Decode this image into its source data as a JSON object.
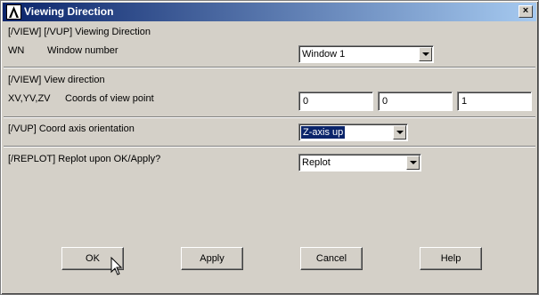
{
  "window": {
    "title": "Viewing Direction",
    "close_glyph": "×"
  },
  "section1": {
    "heading": "[/VIEW] [/VUP] Viewing Direction",
    "wn_label": "WN",
    "wn_desc": "Window number",
    "wn_value": "Window 1"
  },
  "section2": {
    "heading": "[/VIEW]  View direction",
    "coords_label": "XV,YV,ZV",
    "coords_desc": "Coords of view point",
    "xv": "0",
    "yv": "0",
    "zv": "1"
  },
  "section3": {
    "label": "[/VUP]  Coord axis orientation",
    "value": "Z-axis up"
  },
  "section4": {
    "label": "[/REPLOT] Replot upon OK/Apply?",
    "value": "Replot"
  },
  "buttons": {
    "ok": "OK",
    "apply": "Apply",
    "cancel": "Cancel",
    "help": "Help"
  },
  "icons": {
    "app": "ansys-logo-icon",
    "close": "close-icon",
    "cursor": "mouse-cursor-icon"
  },
  "colors": {
    "titlebar_start": "#0a246a",
    "titlebar_end": "#a6caf0",
    "dialog_bg": "#d4d0c8"
  }
}
